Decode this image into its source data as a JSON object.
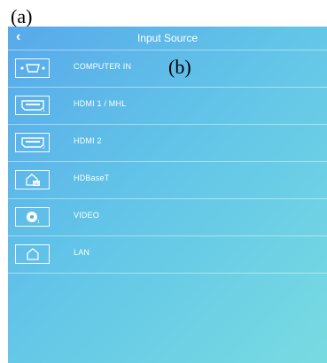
{
  "annotations": {
    "a": "(a)",
    "b": "(b)"
  },
  "header": {
    "back_label": "‹",
    "title": "Input Source"
  },
  "sources": [
    {
      "label": "COMPUTER IN",
      "icon": "vga-connector-icon"
    },
    {
      "label": "HDMI 1 / MHL",
      "icon": "hdmi-1-icon"
    },
    {
      "label": "HDMI 2",
      "icon": "hdmi-2-icon"
    },
    {
      "label": "HDBaseT",
      "icon": "hdbaset-icon"
    },
    {
      "label": "VIDEO",
      "icon": "video-icon"
    },
    {
      "label": "LAN",
      "icon": "lan-home-icon"
    }
  ],
  "colors": {
    "gradient_start": "#58a9ea",
    "gradient_end": "#78dbe1",
    "text": "#ffffff"
  }
}
